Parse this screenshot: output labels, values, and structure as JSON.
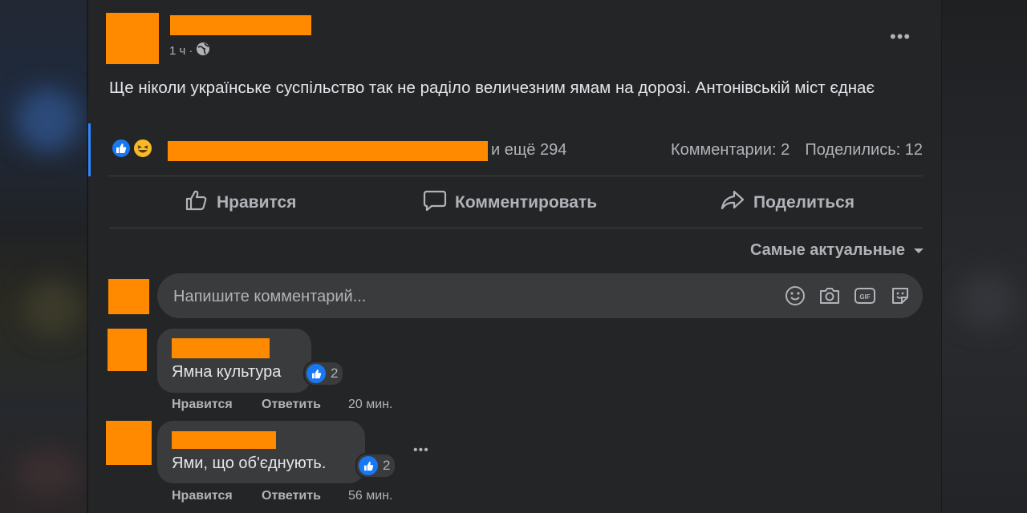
{
  "post": {
    "time": "1 ч",
    "time_sep": "·",
    "text": "Ще ніколи українське суспільство так не раділо величезним ямам на дорозі. Антонівській міст єднає",
    "reactions_others": "и ещё 294",
    "comments_count": "Комментарии: 2",
    "shares_count": "Поделились: 12",
    "more_label": "•••"
  },
  "actions": {
    "like": "Нравится",
    "comment": "Комментировать",
    "share": "Поделиться"
  },
  "sort": {
    "label": "Самые актуальные"
  },
  "comment_input": {
    "placeholder": "Напишите комментарий..."
  },
  "comments": [
    {
      "text": "Ямна культура",
      "likes": "2",
      "like_label": "Нравится",
      "reply_label": "Ответить",
      "time": "20 мин."
    },
    {
      "text": "Ями, що об'єднують.",
      "likes": "2",
      "like_label": "Нравится",
      "reply_label": "Ответить",
      "time": "56 мин."
    }
  ],
  "comment_more": "•••",
  "colors": {
    "accent": "#1877f2",
    "redaction": "#ff8a00",
    "card": "#242526",
    "input": "#3a3b3c"
  }
}
